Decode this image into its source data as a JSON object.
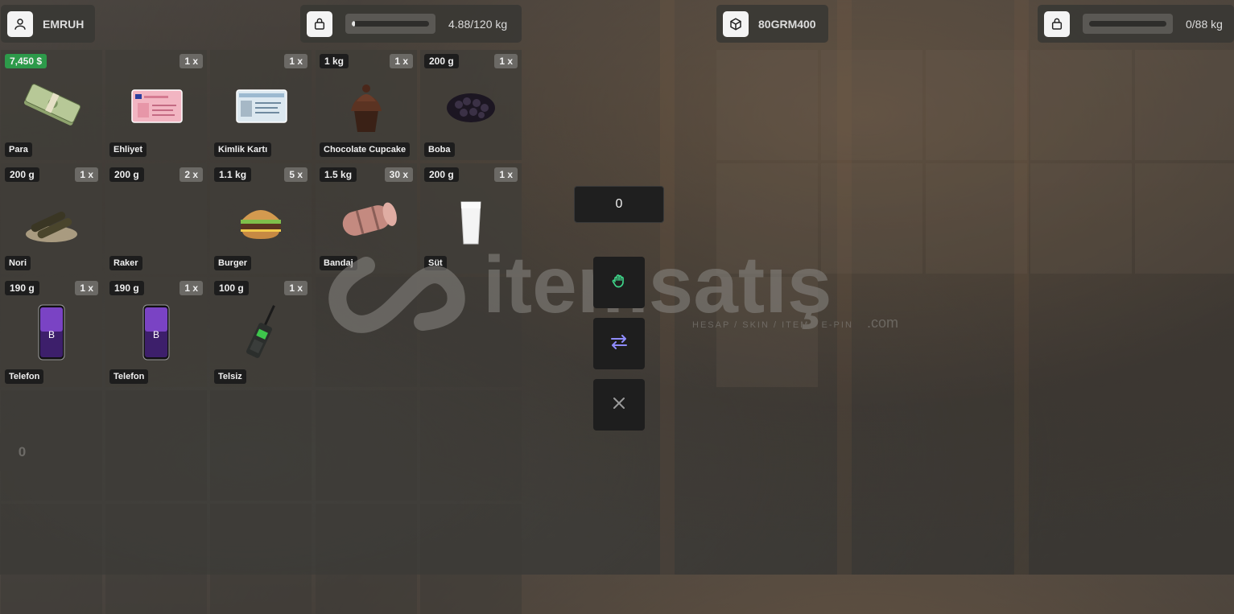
{
  "player": {
    "name": "EMRUH",
    "icon": "user-icon",
    "weight_text": "4.88/120 kg",
    "weight_fraction": 0.04
  },
  "other": {
    "name": "80GRM400",
    "icon": "box-icon",
    "weight_text": "0/88 kg",
    "weight_fraction": 0
  },
  "player_items": [
    {
      "tl": "7,450 $",
      "tr": "",
      "name": "Para",
      "art": "money-icon",
      "money": true
    },
    {
      "tl": "",
      "tr": "1 x",
      "name": "Ehliyet",
      "art": "license-card-icon"
    },
    {
      "tl": "",
      "tr": "1 x",
      "name": "Kimlik Kartı",
      "art": "id-card-icon"
    },
    {
      "tl": "1 kg",
      "tr": "1 x",
      "name": "Chocolate Cupcake",
      "art": "cupcake-icon"
    },
    {
      "tl": "200 g",
      "tr": "1 x",
      "name": "Boba",
      "art": "boba-icon"
    },
    {
      "tl": "200 g",
      "tr": "1 x",
      "name": "Nori",
      "art": "nori-icon"
    },
    {
      "tl": "200 g",
      "tr": "2 x",
      "name": "Raker",
      "art": "none"
    },
    {
      "tl": "1.1 kg",
      "tr": "5 x",
      "name": "Burger",
      "art": "burger-icon"
    },
    {
      "tl": "1.5 kg",
      "tr": "30 x",
      "name": "Bandaj",
      "art": "bandage-icon"
    },
    {
      "tl": "200 g",
      "tr": "1 x",
      "name": "Süt",
      "art": "milk-icon"
    },
    {
      "tl": "190 g",
      "tr": "1 x",
      "name": "Telefon",
      "art": "phone-icon"
    },
    {
      "tl": "190 g",
      "tr": "1 x",
      "name": "Telefon",
      "art": "phone-icon"
    },
    {
      "tl": "100 g",
      "tr": "1 x",
      "name": "Telsiz",
      "art": "radio-icon"
    }
  ],
  "amount_value": "0",
  "side_counter": "0",
  "actions": [
    {
      "name": "use-button",
      "icon": "hand-icon",
      "color": "#3fd68a"
    },
    {
      "name": "give-button",
      "icon": "swap-arrows-icon",
      "color": "#8f8cff"
    },
    {
      "name": "close-button",
      "icon": "close-icon",
      "color": "#9a9a9a"
    }
  ],
  "watermark": {
    "brand": "itemsatış",
    "tagline": "HESAP / SKIN / ITEM / E-PIN",
    "domain": ".com"
  }
}
